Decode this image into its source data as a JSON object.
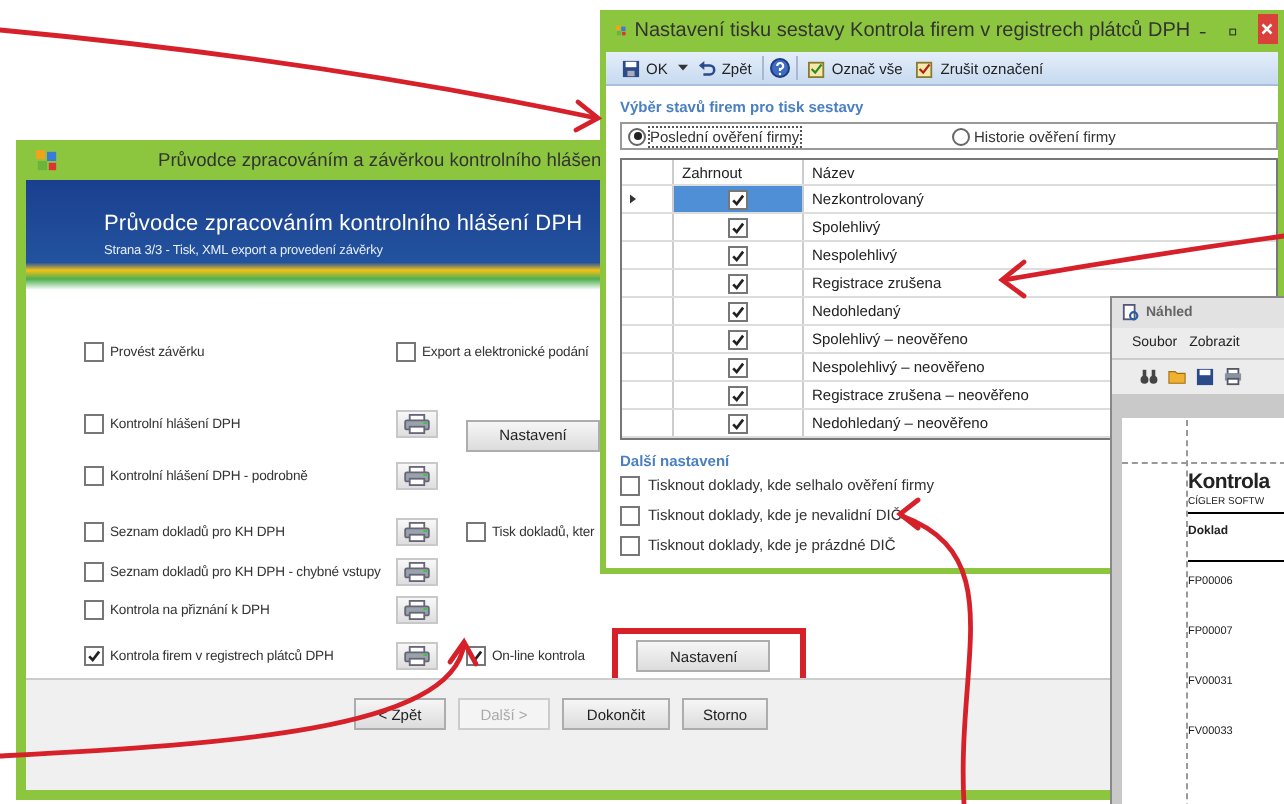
{
  "wizard": {
    "title": "Průvodce zpracováním a závěrkou kontrolního hlášen",
    "banner_title": "Průvodce zpracováním kontrolního hlášení DPH",
    "banner_subtitle": "Strana 3/3 - Tisk, XML export a provedení závěrky",
    "rows": [
      {
        "label": "Provést závěrku",
        "checked": false,
        "print": false,
        "side": [
          {
            "kind": "checkbox",
            "label": "Export a elektronické podání",
            "checked": false
          }
        ]
      },
      {
        "label": "Kontrolní hlášení DPH",
        "checked": false,
        "print": true,
        "side": [
          {
            "kind": "button",
            "label": "Nastavení",
            "highlighted": false
          }
        ]
      },
      {
        "label": "Kontrolní hlášení DPH - podrobně",
        "checked": false,
        "print": true,
        "side": []
      },
      {
        "label": "Seznam dokladů pro KH DPH",
        "checked": false,
        "print": true,
        "side": [
          {
            "kind": "checkbox",
            "label": "Tisk dokladů, kter",
            "checked": false
          }
        ]
      },
      {
        "label": "Seznam dokladů pro KH DPH - chybné vstupy",
        "checked": false,
        "print": true,
        "side": []
      },
      {
        "label": "Kontrola na přiznání k DPH",
        "checked": false,
        "print": true,
        "side": []
      },
      {
        "label": "Kontrola firem v registrech plátců DPH",
        "checked": true,
        "print": true,
        "side": [
          {
            "kind": "checkbox",
            "label": "On-line kontrola",
            "checked": true
          },
          {
            "kind": "button",
            "label": "Nastavení",
            "highlighted": true
          }
        ]
      }
    ],
    "buttons": [
      {
        "label": "< Zpět",
        "disabled": false
      },
      {
        "label": "Další >",
        "disabled": true
      },
      {
        "label": "Dokončit",
        "disabled": false
      },
      {
        "label": "Storno",
        "disabled": false
      }
    ]
  },
  "settings": {
    "title": "Nastavení tisku sestavy Kontrola firem v registrech plátců DPH",
    "toolbar": [
      {
        "kind": "ok",
        "label": "OK"
      },
      {
        "kind": "undo",
        "label": "Zpět"
      },
      {
        "kind": "help"
      },
      {
        "kind": "check",
        "label": "Označ vše"
      },
      {
        "kind": "uncheck",
        "label": "Zrušit označení"
      }
    ],
    "group_title": "Výběr stavů firem pro tisk sestavy",
    "radios": [
      {
        "label": "Poslední ověření firmy",
        "selected": true
      },
      {
        "label": "Historie ověření firmy",
        "selected": false
      }
    ],
    "columns": [
      "Zahrnout",
      "Název"
    ],
    "rows": [
      {
        "name": "Nezkontrolovaný",
        "included": true,
        "selected": true
      },
      {
        "name": "Spolehlivý",
        "included": true,
        "selected": false
      },
      {
        "name": "Nespolehlivý",
        "included": true,
        "selected": false
      },
      {
        "name": "Registrace zrušena",
        "included": true,
        "selected": false
      },
      {
        "name": "Nedohledaný",
        "included": true,
        "selected": false
      },
      {
        "name": "Spolehlivý – neověřeno",
        "included": true,
        "selected": false
      },
      {
        "name": "Nespolehlivý – neověřeno",
        "included": true,
        "selected": false
      },
      {
        "name": "Registrace zrušena – neověřeno",
        "included": true,
        "selected": false
      },
      {
        "name": "Nedohledaný – neověřeno",
        "included": true,
        "selected": false
      }
    ],
    "more_title": "Další nastavení",
    "options": [
      {
        "label": "Tisknout doklady, kde selhalo ověření firmy",
        "checked": false
      },
      {
        "label": "Tisknout doklady, kde je nevalidní DIČ",
        "checked": false
      },
      {
        "label": "Tisknout doklady, kde je prázdné DIČ",
        "checked": false
      }
    ]
  },
  "preview": {
    "title": "Náhled",
    "menu": [
      "Soubor",
      "Zobrazit"
    ],
    "doc_title": "Kontrola",
    "company": "CÍGLER SOFTW",
    "column": "Doklad",
    "rows": [
      "FP00006",
      "FP00007",
      "FV00031",
      "FV00033"
    ]
  }
}
